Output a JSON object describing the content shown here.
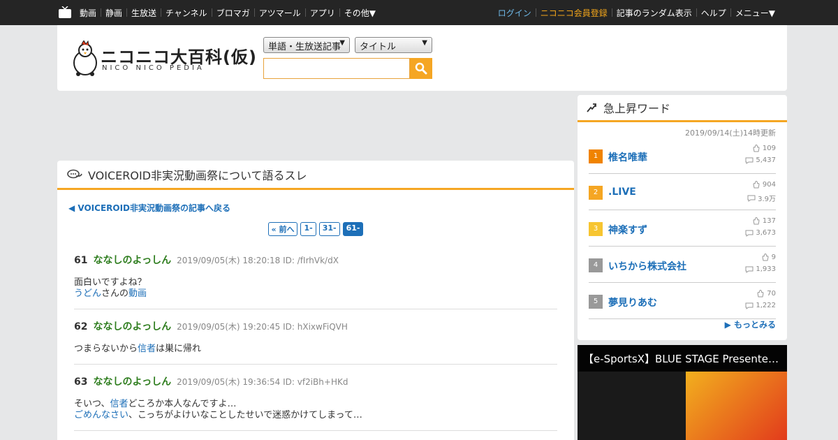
{
  "topbar": {
    "left_items": [
      "動画",
      "静画",
      "生放送",
      "チャンネル",
      "ブロマガ",
      "アツマール",
      "アプリ",
      "その他▼"
    ],
    "right_items": [
      "ログイン",
      "ニコニコ会員登録",
      "記事のランダム表示",
      "ヘルプ",
      "メニュー▼"
    ]
  },
  "header": {
    "brand_title": "ニコニコ大百科(仮)",
    "brand_sub": "NICO NICO PEDIA",
    "select_category": "単語・生放送記事",
    "select_field": "タイトル",
    "search_placeholder": ""
  },
  "thread": {
    "title": "VOICEROID非実況動画祭について語るスレ",
    "back_link": "◀ VOICEROID非実況動画祭の記事へ戻る",
    "pager": [
      "« 前へ",
      "1-",
      "31-",
      "61-"
    ],
    "posts": [
      {
        "num": "61",
        "name": "ななしのよっしん",
        "date": "2019/09/05(木) 18:20:18 ID: /fIrhVk/dX",
        "line1": "面白いですよね？",
        "line2_link1": "うどん",
        "line2_mid": "さんの",
        "line2_link2": "動画"
      },
      {
        "num": "62",
        "name": "ななしのよっしん",
        "date": "2019/09/05(木) 19:20:45 ID: hXixwFiQVH",
        "pre": "つまらないから",
        "link": "信者",
        "post": "は巣に帰れ"
      },
      {
        "num": "63",
        "name": "ななしのよっしん",
        "date": "2019/09/05(木) 19:36:54 ID: vf2iBh+HKd",
        "l1_pre": "そいつ、",
        "l1_link": "信者",
        "l1_post": "どころか本人なんですよ…",
        "l2_link": "ごめんなさい",
        "l2_post": "、こっちがよけいなことしたせいで迷惑かけてしまって…"
      }
    ]
  },
  "sidebar": {
    "title": "急上昇ワード",
    "updated": "2019/09/14(土)14時更新",
    "ranks": [
      {
        "rank": "1",
        "word": "椎名唯華",
        "a": "109",
        "b": "5,437",
        "color": "#f08300"
      },
      {
        "rank": "2",
        "word": ".LIVE",
        "a": "904",
        "b": "3.9万",
        "color": "#f5a623"
      },
      {
        "rank": "3",
        "word": "神楽すず",
        "a": "137",
        "b": "3,673",
        "color": "#f7c531"
      },
      {
        "rank": "4",
        "word": "いちから株式会社",
        "a": "9",
        "b": "1,933",
        "color": "#999999"
      },
      {
        "rank": "5",
        "word": "夢見りあむ",
        "a": "70",
        "b": "1,222",
        "color": "#999999"
      }
    ],
    "more": "もっとみる"
  },
  "banner": {
    "title": "【e-SportsX】BLUE STAGE Presente…"
  }
}
